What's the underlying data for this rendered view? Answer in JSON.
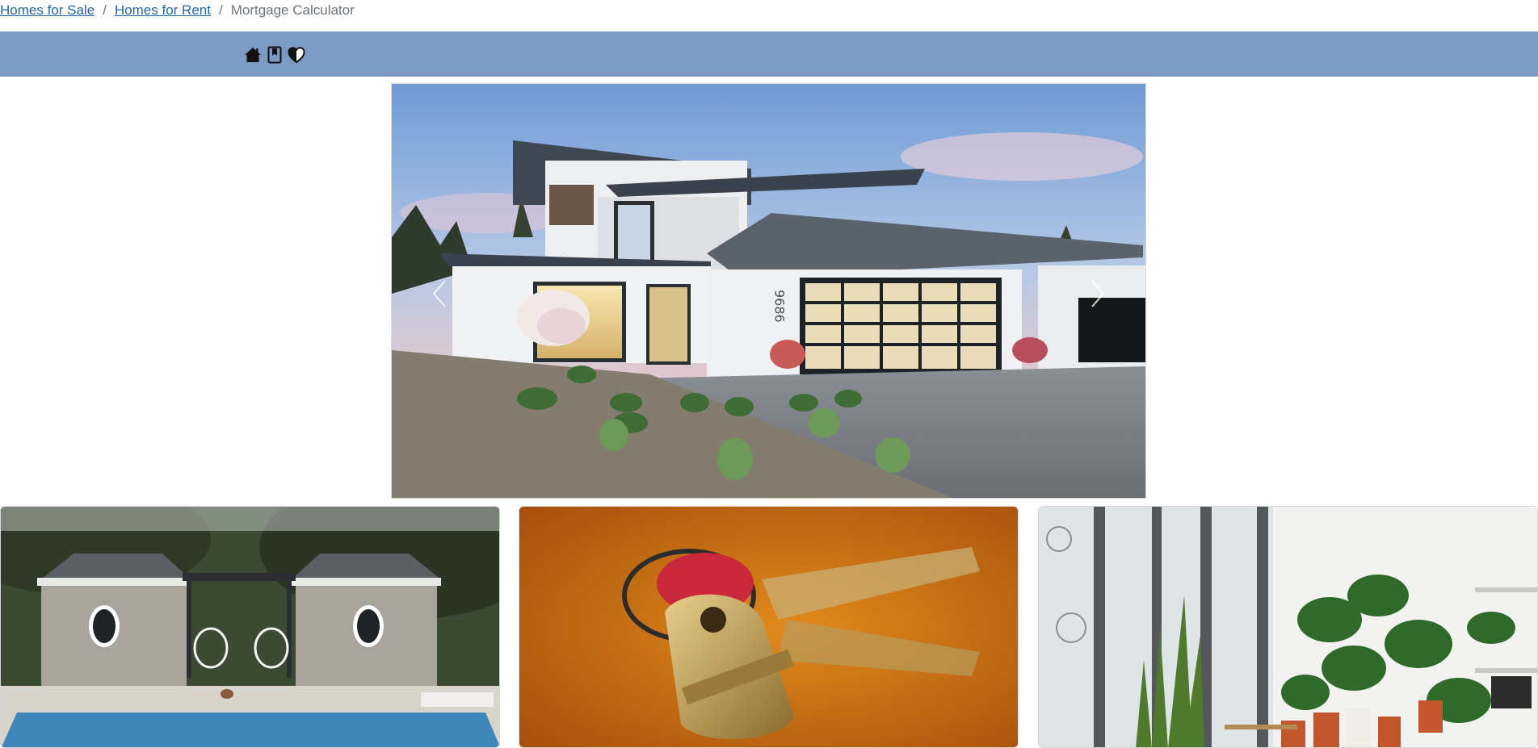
{
  "breadcrumb": {
    "items": [
      {
        "label": "Homes for Sale",
        "link": true
      },
      {
        "label": "Homes for Rent",
        "link": true
      },
      {
        "label": "Mortgage Calculator",
        "link": false
      }
    ],
    "separator": "/"
  },
  "topbar": {
    "color": "#7b9bc4",
    "icons": [
      "house-icon",
      "bookmark-icon",
      "heart-icon"
    ]
  },
  "carousel": {
    "image": "modern-house-exterior-photo",
    "house_number": "9686",
    "controls": [
      "previous-arrow",
      "next-arrow"
    ]
  },
  "cards": [
    {
      "image": "backyard-pool-photo"
    },
    {
      "image": "house-keys-photo"
    },
    {
      "image": "indoor-plants-photo"
    }
  ],
  "colors": {
    "link": "#2366a8",
    "muted": "#6c757d",
    "bar": "#7b9bc4"
  }
}
